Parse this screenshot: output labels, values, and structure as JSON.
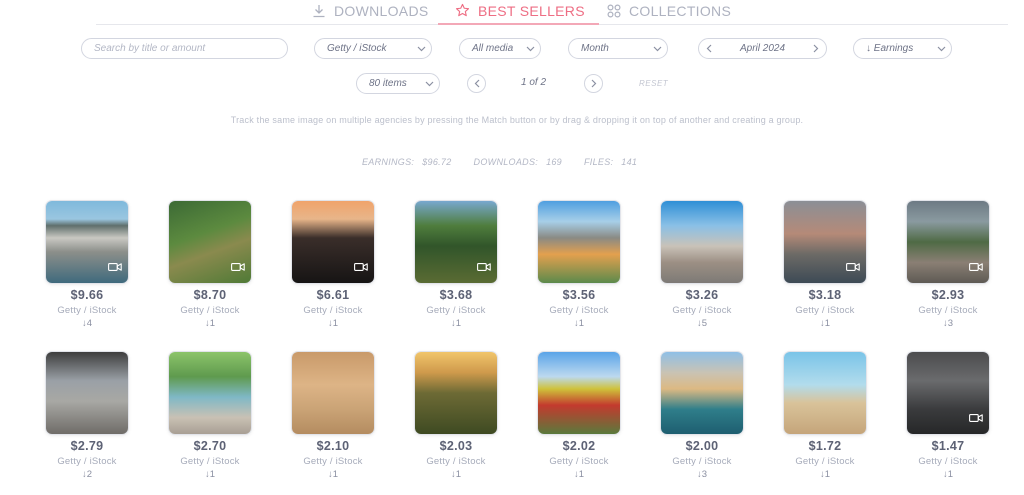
{
  "tabs": [
    {
      "label": "DOWNLOADS",
      "icon": "download-icon",
      "active": false
    },
    {
      "label": "BEST SELLERS",
      "icon": "star-icon",
      "active": true
    },
    {
      "label": "COLLECTIONS",
      "icon": "grid-icon",
      "active": false
    }
  ],
  "filters": {
    "search_placeholder": "Search by title or amount",
    "agency": "Getty / iStock",
    "media": "All media",
    "period": "Month",
    "date": "April 2024",
    "sort": "↓ Earnings",
    "items": "80 items"
  },
  "pager": {
    "text": "1 of 2",
    "reset": "RESET"
  },
  "info_text": "Track the same image on multiple agencies by pressing the Match button or by drag & dropping it on top of another and creating a group.",
  "stats": {
    "earnings_label": "EARNINGS:",
    "earnings": "$96.72",
    "downloads_label": "DOWNLOADS:",
    "downloads": "169",
    "files_label": "FILES:",
    "files": "141"
  },
  "accent_color": "#ee6e84",
  "cards": [
    {
      "price": "$9.66",
      "agency": "Getty / iStock",
      "downloads": "↓4",
      "video": true
    },
    {
      "price": "$8.70",
      "agency": "Getty / iStock",
      "downloads": "↓1",
      "video": true
    },
    {
      "price": "$6.61",
      "agency": "Getty / iStock",
      "downloads": "↓1",
      "video": true
    },
    {
      "price": "$3.68",
      "agency": "Getty / iStock",
      "downloads": "↓1",
      "video": true
    },
    {
      "price": "$3.56",
      "agency": "Getty / iStock",
      "downloads": "↓1",
      "video": false
    },
    {
      "price": "$3.26",
      "agency": "Getty / iStock",
      "downloads": "↓5",
      "video": false
    },
    {
      "price": "$3.18",
      "agency": "Getty / iStock",
      "downloads": "↓1",
      "video": true
    },
    {
      "price": "$2.93",
      "agency": "Getty / iStock",
      "downloads": "↓3",
      "video": true
    },
    {
      "price": "$2.79",
      "agency": "Getty / iStock",
      "downloads": "↓2",
      "video": false
    },
    {
      "price": "$2.70",
      "agency": "Getty / iStock",
      "downloads": "↓1",
      "video": false
    },
    {
      "price": "$2.10",
      "agency": "Getty / iStock",
      "downloads": "↓1",
      "video": false
    },
    {
      "price": "$2.03",
      "agency": "Getty / iStock",
      "downloads": "↓1",
      "video": false
    },
    {
      "price": "$2.02",
      "agency": "Getty / iStock",
      "downloads": "↓1",
      "video": false
    },
    {
      "price": "$2.00",
      "agency": "Getty / iStock",
      "downloads": "↓3",
      "video": false
    },
    {
      "price": "$1.72",
      "agency": "Getty / iStock",
      "downloads": "↓1",
      "video": false
    },
    {
      "price": "$1.47",
      "agency": "Getty / iStock",
      "downloads": "↓1",
      "video": true
    }
  ]
}
